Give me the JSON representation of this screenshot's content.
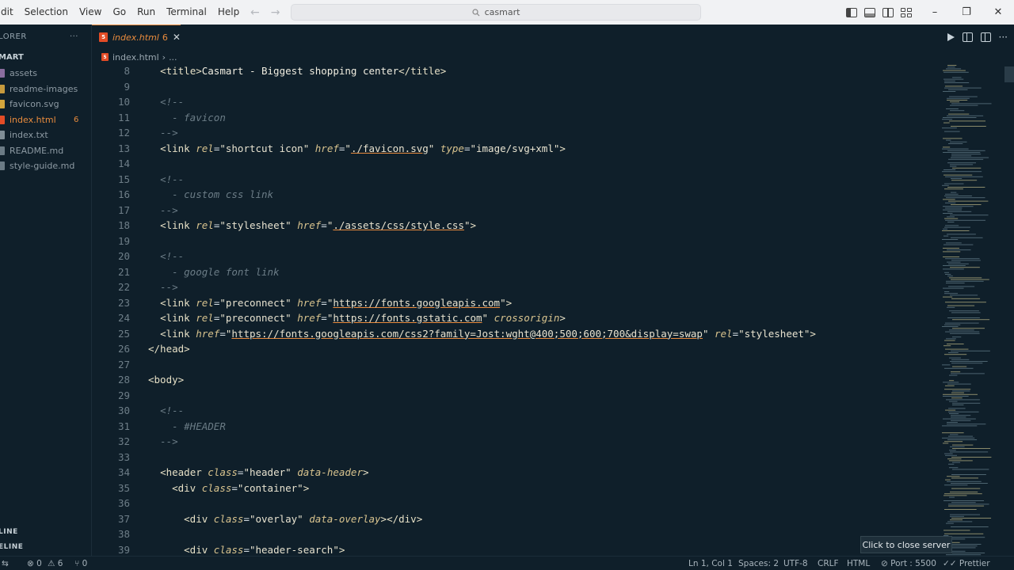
{
  "menu": [
    "dit",
    "Selection",
    "View",
    "Go",
    "Run",
    "Terminal",
    "Help"
  ],
  "command_center": {
    "text": "casmart"
  },
  "window_controls": {
    "minimize": "–",
    "restore": "❐",
    "close": "✕"
  },
  "sidebar": {
    "header": "LORER",
    "more": "···",
    "folder": "MART",
    "files": [
      {
        "name": "assets",
        "type": "folder",
        "color": "#8a6d9e"
      },
      {
        "name": "readme-images",
        "type": "folder",
        "color": "#c69a3d"
      },
      {
        "name": "favicon.svg",
        "type": "svg",
        "color": "#d4a63c"
      },
      {
        "name": "index.html",
        "type": "html",
        "color": "#e34c26",
        "badge": "6"
      },
      {
        "name": "index.txt",
        "type": "txt",
        "color": "#7f8d96"
      },
      {
        "name": "README.md",
        "type": "md",
        "color": "#6b7b85"
      },
      {
        "name": "style-guide.md",
        "type": "md",
        "color": "#6b7b85"
      }
    ],
    "outline": "LINE",
    "timeline": "ELINE"
  },
  "tab": {
    "label": "index.html",
    "badge": "6",
    "close": "✕",
    "icon_text": "5"
  },
  "breadcrumb": {
    "file": "index.html",
    "sep": "›",
    "rest": "..."
  },
  "code_lines": [
    {
      "n": "8",
      "html": "  <span class='tag'>&lt;title&gt;</span><span class='txt'>Casmart - Biggest shopping center</span><span class='tag'>&lt;/title&gt;</span>"
    },
    {
      "n": "9",
      "html": ""
    },
    {
      "n": "10",
      "html": "  <span class='cmt'>&lt;!--</span>"
    },
    {
      "n": "11",
      "html": "    <span class='cmt'>- favicon</span>"
    },
    {
      "n": "12",
      "html": "  <span class='cmt'>--&gt;</span>"
    },
    {
      "n": "13",
      "html": "  <span class='tag'>&lt;link</span> <span class='attr'>rel</span>=<span class='str'>\"shortcut icon\"</span> <span class='attr'>href</span>=<span class='str'>\"<span class='url'>./favicon.svg</span>\"</span> <span class='attr'>type</span>=<span class='str'>\"image/svg+xml\"</span><span class='tag'>&gt;</span>"
    },
    {
      "n": "14",
      "html": ""
    },
    {
      "n": "15",
      "html": "  <span class='cmt'>&lt;!--</span>"
    },
    {
      "n": "16",
      "html": "    <span class='cmt'>- custom css link</span>"
    },
    {
      "n": "17",
      "html": "  <span class='cmt'>--&gt;</span>"
    },
    {
      "n": "18",
      "html": "  <span class='tag'>&lt;link</span> <span class='attr'>rel</span>=<span class='str'>\"stylesheet\"</span> <span class='attr'>href</span>=<span class='str'>\"<span class='url'>./assets/css/style.css</span>\"</span><span class='tag'>&gt;</span>"
    },
    {
      "n": "19",
      "html": ""
    },
    {
      "n": "20",
      "html": "  <span class='cmt'>&lt;!--</span>"
    },
    {
      "n": "21",
      "html": "    <span class='cmt'>- google font link</span>"
    },
    {
      "n": "22",
      "html": "  <span class='cmt'>--&gt;</span>"
    },
    {
      "n": "23",
      "html": "  <span class='tag'>&lt;link</span> <span class='attr'>rel</span>=<span class='str'>\"preconnect\"</span> <span class='attr'>href</span>=<span class='str'>\"<span class='url'>https://fonts.googleapis.com</span>\"</span><span class='tag'>&gt;</span>"
    },
    {
      "n": "24",
      "html": "  <span class='tag'>&lt;link</span> <span class='attr'>rel</span>=<span class='str'>\"preconnect\"</span> <span class='attr'>href</span>=<span class='str'>\"<span class='url'>https://fonts.gstatic.com</span>\"</span> <span class='attr'>crossorigin</span><span class='tag'>&gt;</span>"
    },
    {
      "n": "25",
      "html": "  <span class='tag'>&lt;link</span> <span class='attr'>href</span>=<span class='str'>\"<span class='url'>https://fonts.googleapis.com/css2?family=Jost:wght@400;500;600;700&amp;display=swap</span>\"</span> <span class='attr'>rel</span>=<span class='str'>\"stylesheet\"</span><span class='tag'>&gt;</span>"
    },
    {
      "n": "26",
      "html": "<span class='tag'>&lt;/head&gt;</span>"
    },
    {
      "n": "27",
      "html": ""
    },
    {
      "n": "28",
      "html": "<span class='tag'>&lt;body&gt;</span>"
    },
    {
      "n": "29",
      "html": ""
    },
    {
      "n": "30",
      "html": "  <span class='cmt'>&lt;!--</span>"
    },
    {
      "n": "31",
      "html": "    <span class='cmt'>- #HEADER</span>"
    },
    {
      "n": "32",
      "html": "  <span class='cmt'>--&gt;</span>"
    },
    {
      "n": "33",
      "html": ""
    },
    {
      "n": "34",
      "html": "  <span class='tag'>&lt;header</span> <span class='attr'>class</span>=<span class='str'>\"header\"</span> <span class='attr'>data-header</span><span class='tag'>&gt;</span>"
    },
    {
      "n": "35",
      "html": "    <span class='tag'>&lt;div</span> <span class='attr'>class</span>=<span class='str'>\"container\"</span><span class='tag'>&gt;</span>"
    },
    {
      "n": "36",
      "html": ""
    },
    {
      "n": "37",
      "html": "      <span class='tag'>&lt;div</span> <span class='attr'>class</span>=<span class='str'>\"overlay\"</span> <span class='attr'>data-overlay</span><span class='tag'>&gt;&lt;/div&gt;</span>"
    },
    {
      "n": "38",
      "html": ""
    },
    {
      "n": "39",
      "html": "      <span class='tag'>&lt;div</span> <span class='attr'>class</span>=<span class='str'>\"header-search\"</span><span class='tag'>&gt;</span>"
    }
  ],
  "tooltip": "Click to close server",
  "status": {
    "remote": "⇆",
    "errors": "⊗ 0",
    "warnings": "⚠ 6",
    "ports": "⑂ 0",
    "position": "Ln 1, Col 1",
    "spaces": "Spaces: 2",
    "encoding": "UTF-8",
    "eol": "CRLF",
    "language": "HTML",
    "live_server": "⊘ Port : 5500",
    "prettier": "✓✓ Prettier"
  }
}
